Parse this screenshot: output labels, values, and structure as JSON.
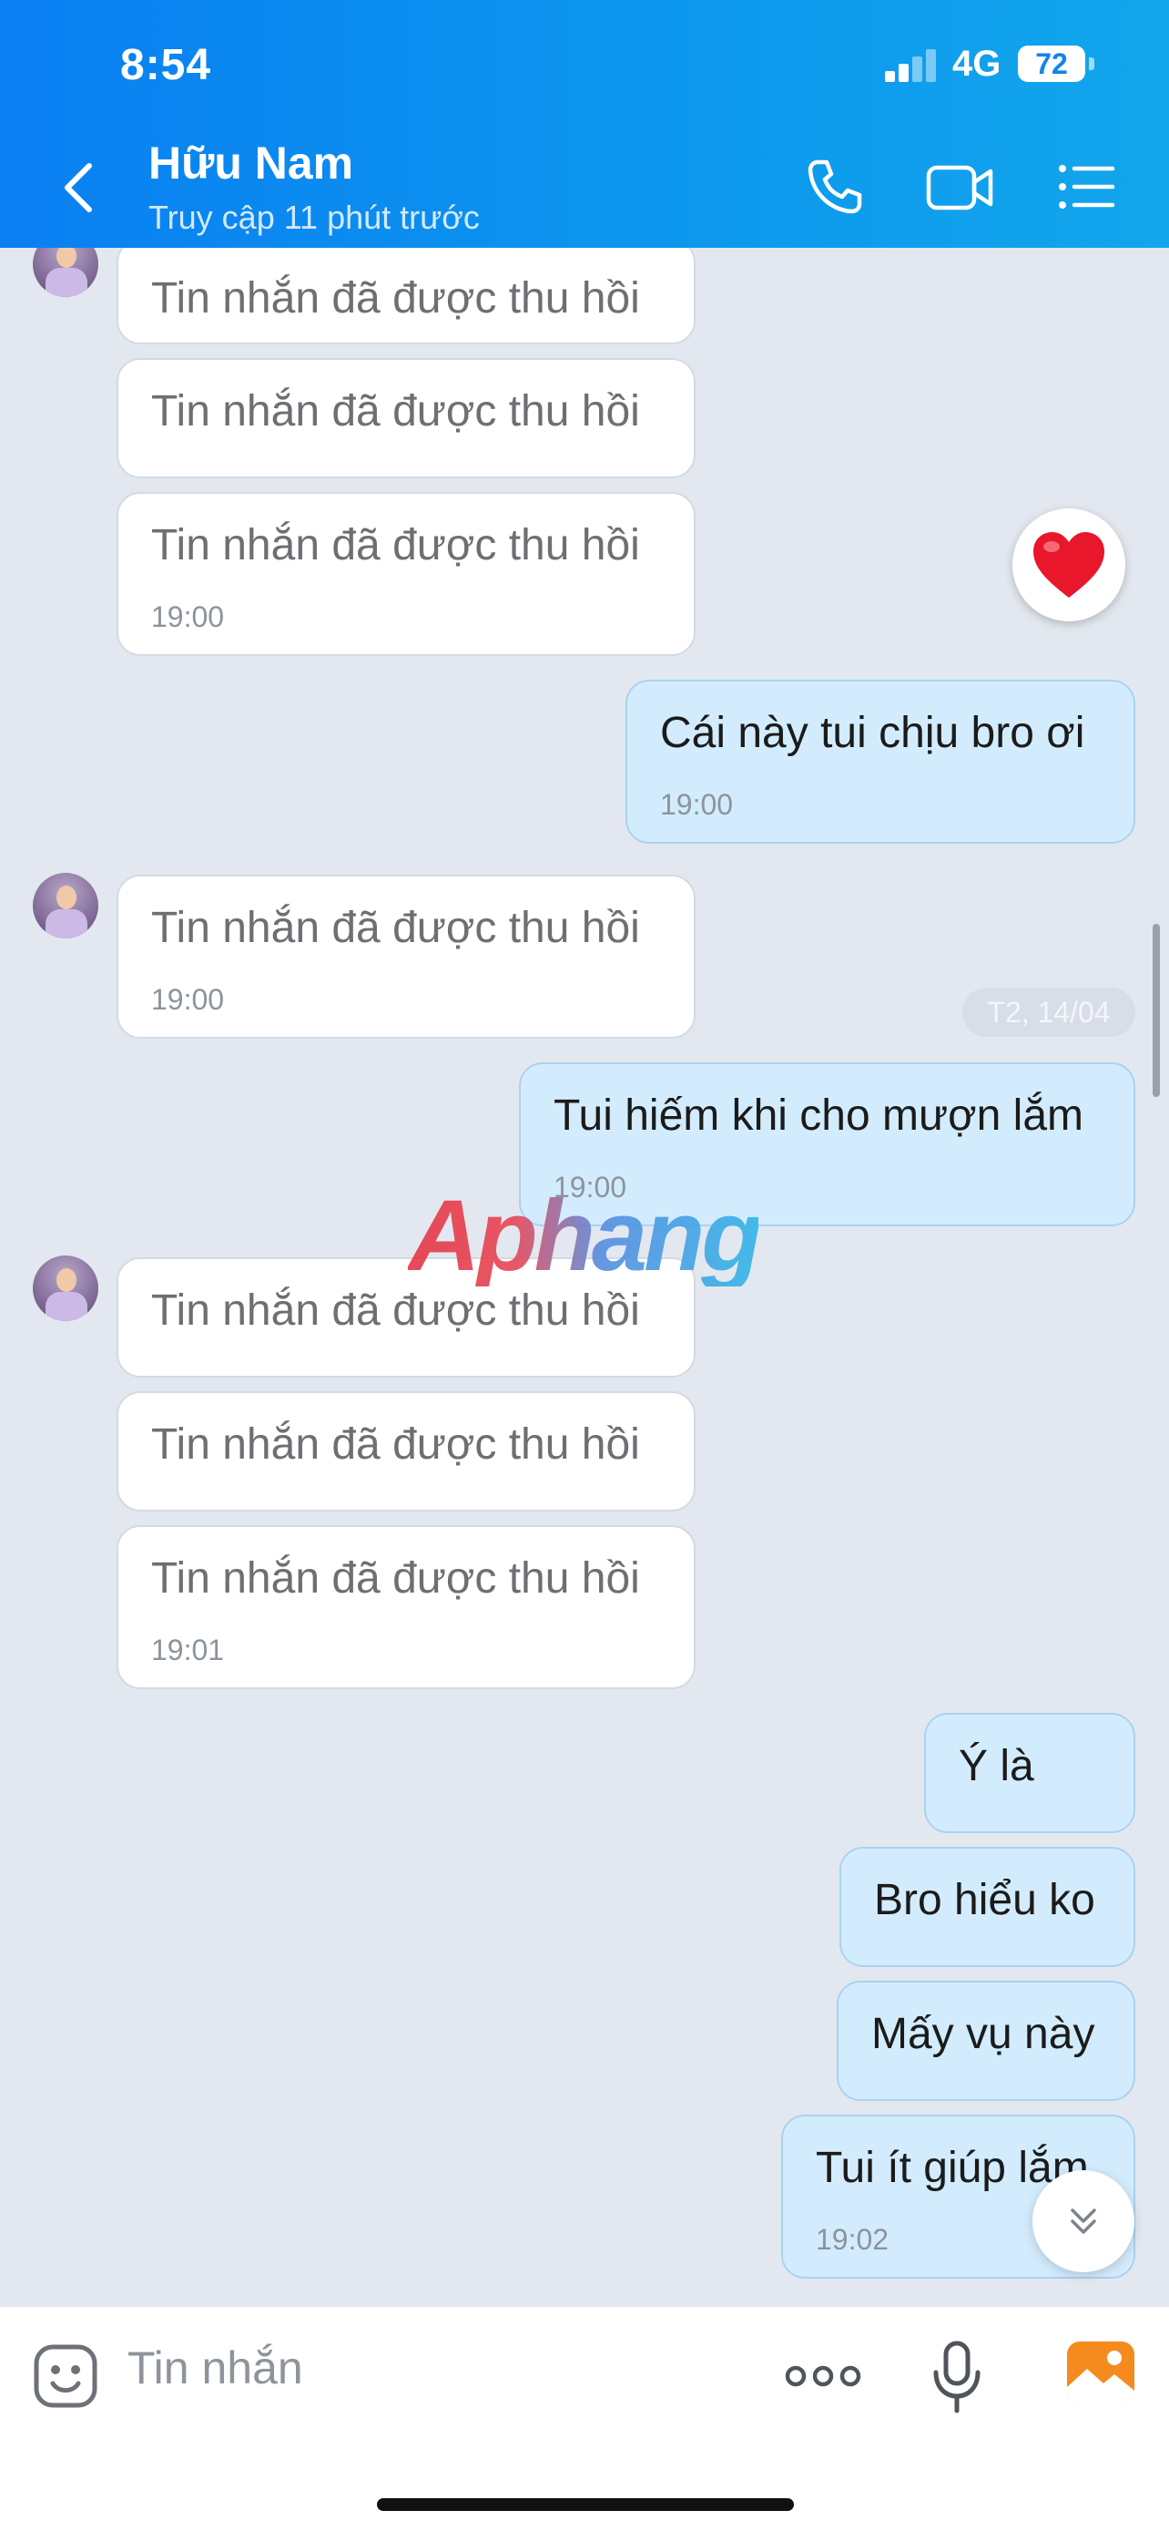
{
  "status_bar": {
    "time": "8:54",
    "network": "4G",
    "battery": "72"
  },
  "header": {
    "contact_name": "Hữu Nam",
    "last_seen": "Truy cập 11 phút trước"
  },
  "messages": [
    {
      "text": "Tin nhắn đã được thu hồi"
    },
    {
      "text": "Tin nhắn đã được thu hồi"
    },
    {
      "text": "Tin nhắn đã được thu hồi",
      "time": "19:00"
    },
    {
      "text": "Cái này tui chịu bro ơi",
      "time": "19:00"
    },
    {
      "text": "Tin nhắn đã được thu hồi",
      "time": "19:00"
    },
    {
      "text": "Tui hiếm khi cho mượn lắm",
      "time": "19:00"
    },
    {
      "text": "Tin nhắn đã được thu hồi"
    },
    {
      "text": "Tin nhắn đã được thu hồi"
    },
    {
      "text": "Tin nhắn đã được thu hồi",
      "time": "19:01"
    },
    {
      "text": "Ý là"
    },
    {
      "text": "Bro hiểu ko"
    },
    {
      "text": "Mấy vụ này"
    },
    {
      "text": "Tui ít giúp lắm",
      "time": "19:02"
    }
  ],
  "date_separator": "T2, 14/04",
  "watermark": "Aphang",
  "composer": {
    "placeholder": "Tin nhắn"
  },
  "colors": {
    "header": "#0c8ff0",
    "incoming_bubble": "#ffffff",
    "outgoing_bubble": "#d3ecfd",
    "background": "#e3e8f0"
  }
}
